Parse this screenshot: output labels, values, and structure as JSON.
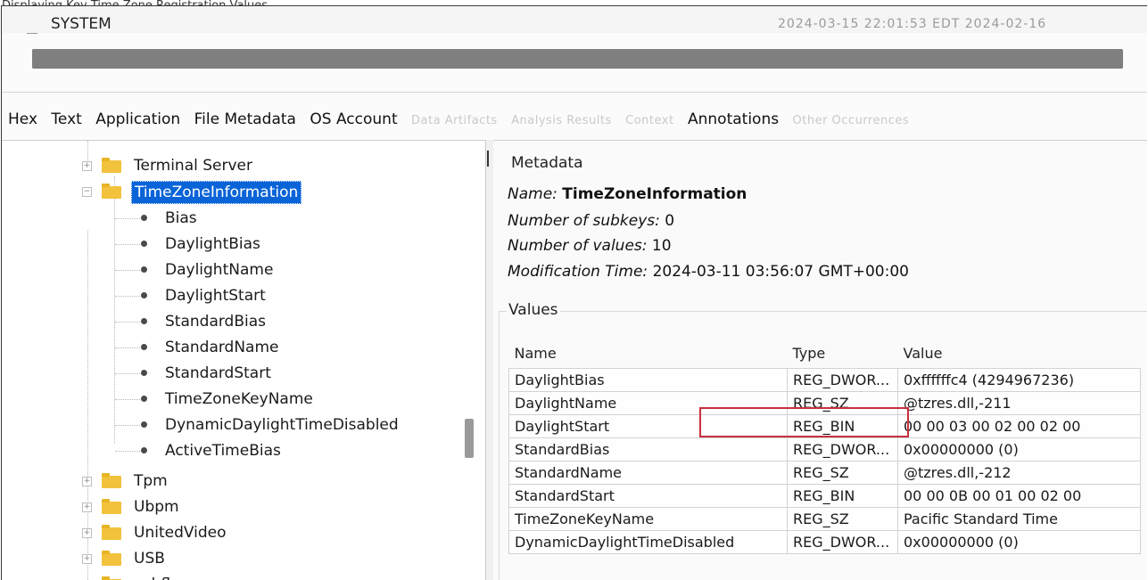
{
  "caption": "Displaying Key Time Zone Registration Values",
  "file": {
    "name": "SYSTEM",
    "timestamps": "2024-03-15 22:01:53 EDT   2024-02-16"
  },
  "progress_fraction": 1.0,
  "tabs": [
    {
      "label": "Hex",
      "disabled": false
    },
    {
      "label": "Text",
      "disabled": false
    },
    {
      "label": "Application",
      "disabled": false,
      "active": true
    },
    {
      "label": "File Metadata",
      "disabled": false
    },
    {
      "label": "OS Account",
      "disabled": false
    },
    {
      "label": "Data Artifacts",
      "disabled": true
    },
    {
      "label": "Analysis Results",
      "disabled": true
    },
    {
      "label": "Context",
      "disabled": true
    },
    {
      "label": "Annotations",
      "disabled": false
    },
    {
      "label": "Other Occurrences",
      "disabled": true
    }
  ],
  "tree": {
    "terminal_server": "Terminal Server",
    "selected_key": "TimeZoneInformation",
    "values": [
      "Bias",
      "DaylightBias",
      "DaylightName",
      "DaylightStart",
      "StandardBias",
      "StandardName",
      "StandardStart",
      "TimeZoneKeyName",
      "DynamicDaylightTimeDisabled",
      "ActiveTimeBias"
    ],
    "siblings": [
      "Tpm",
      "Ubpm",
      "UnitedVideo",
      "USB",
      "usbflags"
    ]
  },
  "metadata": {
    "section_title": "Metadata",
    "name_label": "Name:",
    "name_value": "TimeZoneInformation",
    "subkeys_label": "Number of subkeys:",
    "subkeys_value": "0",
    "values_label": "Number of values:",
    "values_value": "10",
    "modtime_label": "Modification Time:",
    "modtime_value": "2024-03-11 03:56:07 GMT+00:00"
  },
  "values_table": {
    "section_title": "Values",
    "headers": [
      "Name",
      "Type",
      "Value"
    ],
    "rows": [
      [
        "DaylightBias",
        "REG_DWOR...",
        "0xffffffc4 (4294967236)"
      ],
      [
        "DaylightName",
        "REG_SZ",
        "@tzres.dll,-211"
      ],
      [
        "DaylightStart",
        "REG_BIN",
        "00 00 03 00 02 00 02 00"
      ],
      [
        "StandardBias",
        "REG_DWOR...",
        "0x00000000 (0)"
      ],
      [
        "StandardName",
        "REG_SZ",
        "@tzres.dll,-212"
      ],
      [
        "StandardStart",
        "REG_BIN",
        "00 00 0B 00 01 00 02 00"
      ],
      [
        "TimeZoneKeyName",
        "REG_SZ",
        "Pacific Standard Time"
      ],
      [
        "DynamicDaylightTimeDisabled",
        "REG_DWOR...",
        "0x00000000 (0)"
      ]
    ]
  },
  "colors": {
    "selection": "#0a64d8",
    "highlight_border": "#c9303f",
    "folder": "#f2c23c"
  }
}
